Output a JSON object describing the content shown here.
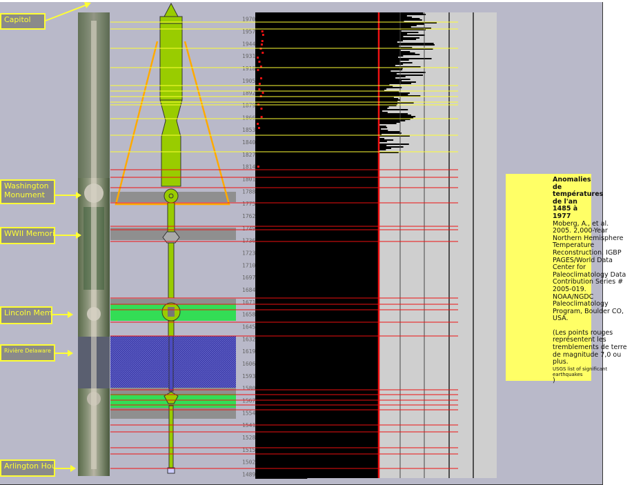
{
  "labels": {
    "capitol": "Capitol",
    "washington": "Washington\nMonument",
    "wwii": "WWII Memorial",
    "lincoln": "Lincoln Memorial",
    "riviere": "Rivière Delaware",
    "arlington": "Arlington House"
  },
  "note": {
    "title": "Anomalies de températures de l'an 1485 à 1977",
    "citation": "Moberg, A., et al. 2005. 2,000-Year Northern Hemisphere Temperature Reconstruction. IGBP PAGES/World Data Center for Paleoclimatology Data Contribution Series # 2005-019. NOAA/NGDC Paleoclimatology Program, Boulder CO, USA.",
    "remark": "(Les points rouges représentent les tremblements de terre de magnitude 7,0 ou plus.",
    "remark_small": "USGS list of significant earthquakes",
    "remark_end": ")"
  },
  "colors": {
    "monument": "#99cc00",
    "pool_green": "#33dd55",
    "river_blue": "#4040b0",
    "yellow_line": "#ffff33",
    "red_line": "#ee1111",
    "bars": "#000000"
  },
  "chart_data": {
    "type": "bar",
    "orientation": "horizontal",
    "year_labels": [
      "1970",
      "1957",
      "1944",
      "1931",
      "1918",
      "1905",
      "1892",
      "1879",
      "1866",
      "1853",
      "1840",
      "1827",
      "1814",
      "1801",
      "1788",
      "1775",
      "1762",
      "1749",
      "1736",
      "1723",
      "1710",
      "1697",
      "1684",
      "1671",
      "1658",
      "1645",
      "1632",
      "1619",
      "1606",
      "1593",
      "1580",
      "1567",
      "1554",
      "1541",
      "1528",
      "1515",
      "1502",
      "1489"
    ],
    "year_range": [
      1485,
      1977
    ],
    "notes": "Yearly temperature anomaly bars; red dots mark earthquakes of magnitude 7.0 or more."
  }
}
